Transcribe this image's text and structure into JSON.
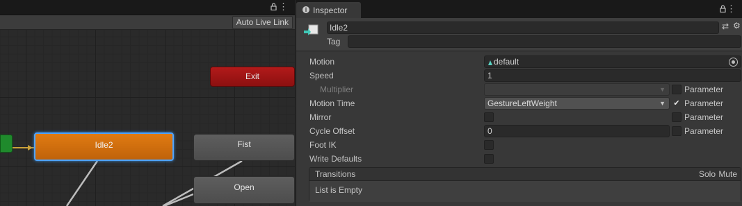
{
  "animator": {
    "toolbar": {
      "auto_live_link": "Auto Live Link"
    },
    "states": {
      "exit": "Exit",
      "idle2": "Idle2",
      "fist": "Fist",
      "open": "Open"
    },
    "colors": {
      "default_state": "#e07b12",
      "exit_state": "#b21a1a",
      "entry_state": "#1f8a2c",
      "normal_state": "#5e5e5e",
      "selection_outline": "#4da3ff"
    }
  },
  "inspector": {
    "tab_title": "Inspector",
    "state_name": "Idle2",
    "tag_label": "Tag",
    "tag_value": "",
    "properties": {
      "motion": {
        "label": "Motion",
        "value": "default"
      },
      "speed": {
        "label": "Speed",
        "value": "1"
      },
      "multiplier": {
        "label": "Multiplier",
        "value": "",
        "param_label": "Parameter",
        "param_checked": false
      },
      "motion_time": {
        "label": "Motion Time",
        "value": "GestureLeftWeight",
        "param_label": "Parameter",
        "param_checked": true
      },
      "mirror": {
        "label": "Mirror",
        "checked": false,
        "param_label": "Parameter",
        "param_checked": false
      },
      "cycle_offset": {
        "label": "Cycle Offset",
        "value": "0",
        "param_label": "Parameter",
        "param_checked": false
      },
      "foot_ik": {
        "label": "Foot IK",
        "checked": false
      },
      "write_defaults": {
        "label": "Write Defaults",
        "checked": false
      }
    },
    "transitions": {
      "title": "Transitions",
      "solo": "Solo",
      "mute": "Mute",
      "empty_text": "List is Empty"
    }
  }
}
